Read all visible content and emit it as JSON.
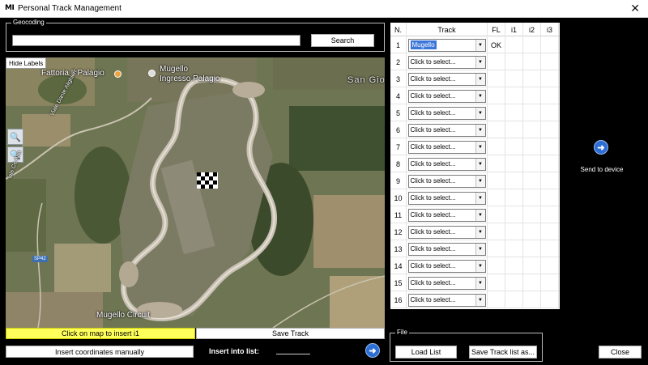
{
  "window": {
    "logo": "MI",
    "title": "Personal Track Management",
    "close_glyph": "✕"
  },
  "geocoding": {
    "legend": "Geocoding",
    "input_value": "",
    "search_label": "Search"
  },
  "map": {
    "hide_labels": "Hide Labels",
    "zoom_in_glyph": "🔍",
    "zoom_out_glyph": "🔍",
    "labels": {
      "fattoria": "Fattoria Il Palagio",
      "mugello_palagio_1": "Mugello",
      "mugello_palagio_2": "Ingresso Palagio",
      "san_gio": "San Gio",
      "viale_dante": "Viale Dante Alighieri",
      "viale_cedent": "iale Ce Aua",
      "sp42": "SP42",
      "circuit": "Mugello Circuit"
    },
    "colors": {
      "terrain": "#6e7552",
      "track_asphalt": "#c8c1b4",
      "poi": "#f0a23b"
    }
  },
  "actions": {
    "click_map": "Click on map to insert i1",
    "save_track": "Save Track",
    "insert_coords": "Insert coordinates manually",
    "insert_into_list": "Insert into list:",
    "arrow_glyph": "➜"
  },
  "tracks": {
    "headers": [
      "N.",
      "Track",
      "FL",
      "i1",
      "i2",
      "i3"
    ],
    "rows": [
      {
        "n": "1",
        "track": "Mugello",
        "fl": "OK",
        "selected": true
      },
      {
        "n": "2",
        "track": "Click to select...",
        "fl": ""
      },
      {
        "n": "3",
        "track": "Click to select...",
        "fl": ""
      },
      {
        "n": "4",
        "track": "Click to select...",
        "fl": ""
      },
      {
        "n": "5",
        "track": "Click to select...",
        "fl": ""
      },
      {
        "n": "6",
        "track": "Click to select...",
        "fl": ""
      },
      {
        "n": "7",
        "track": "Click to select...",
        "fl": ""
      },
      {
        "n": "8",
        "track": "Click to select...",
        "fl": ""
      },
      {
        "n": "9",
        "track": "Click to select...",
        "fl": ""
      },
      {
        "n": "10",
        "track": "Click to select...",
        "fl": ""
      },
      {
        "n": "11",
        "track": "Click to select...",
        "fl": ""
      },
      {
        "n": "12",
        "track": "Click to select...",
        "fl": ""
      },
      {
        "n": "13",
        "track": "Click to select...",
        "fl": ""
      },
      {
        "n": "14",
        "track": "Click to select...",
        "fl": ""
      },
      {
        "n": "15",
        "track": "Click to select...",
        "fl": ""
      },
      {
        "n": "16",
        "track": "Click to select...",
        "fl": ""
      }
    ]
  },
  "device": {
    "send_label": "Send to device"
  },
  "file": {
    "legend": "File",
    "load_list": "Load List",
    "save_list": "Save Track list as..."
  },
  "footer": {
    "close_label": "Close"
  }
}
